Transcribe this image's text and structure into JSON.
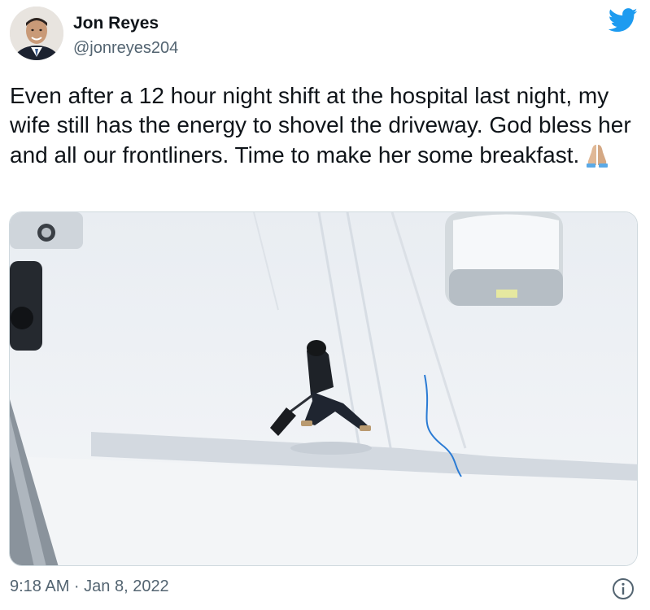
{
  "author": {
    "name": "Jon Reyes",
    "handle": "@jonreyes204",
    "avatar_icon": "profile-avatar"
  },
  "tweet": {
    "text": "Even after a 12 hour night shift at the hospital last night, my wife still has the energy to shovel the driveway. God bless her and all our frontliners. Time to make her some breakfast.",
    "emoji_icon": "folded-hands-emoji",
    "media_icon": "snowy-driveway-photo"
  },
  "footer": {
    "timestamp": "9:18 AM · Jan 8, 2022",
    "info_icon": "info-icon"
  },
  "colors": {
    "brand": "#1d9bf0",
    "text": "#0f1419",
    "secondary": "#536471"
  }
}
